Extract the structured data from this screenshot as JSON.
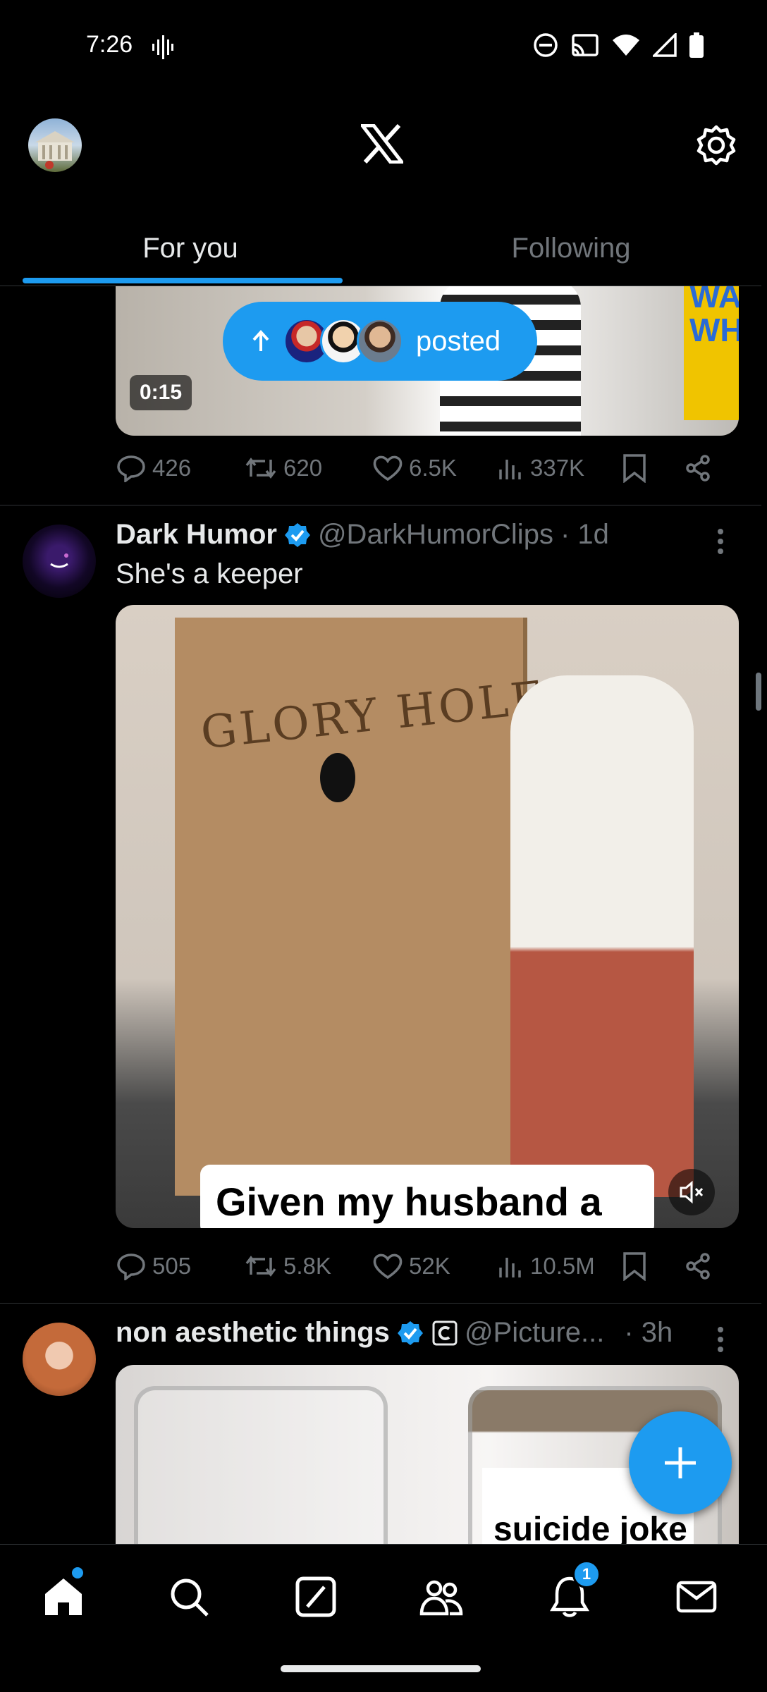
{
  "status_bar": {
    "time": "7:26"
  },
  "header": {
    "tabs": [
      {
        "label": "For you"
      },
      {
        "label": "Following"
      }
    ]
  },
  "tweet_prev": {
    "duration": "0:15",
    "posted_label": "posted",
    "stats": {
      "replies": "426",
      "reposts": "620",
      "likes": "6.5K",
      "views": "337K"
    }
  },
  "tweet_dark_humor": {
    "name": "Dark Humor",
    "handle": "@DarkHumorClips",
    "time": "· 1d",
    "text": "She's a keeper",
    "media_caption": "Given my husband a",
    "media_handwriting": "GLORY HOLE",
    "stats": {
      "replies": "505",
      "reposts": "5.8K",
      "likes": "52K",
      "views": "10.5M"
    }
  },
  "tweet_non_aesthetic": {
    "name": "non aesthetic things",
    "handle": "@Picture...",
    "time": "· 3h",
    "jar_label": "suicide joke"
  },
  "bottom_nav": {
    "notifications_badge": "1"
  },
  "colors": {
    "accent": "#1d9bf0",
    "background": "#000000",
    "muted": "#71767b",
    "text": "#e7e9ea"
  }
}
